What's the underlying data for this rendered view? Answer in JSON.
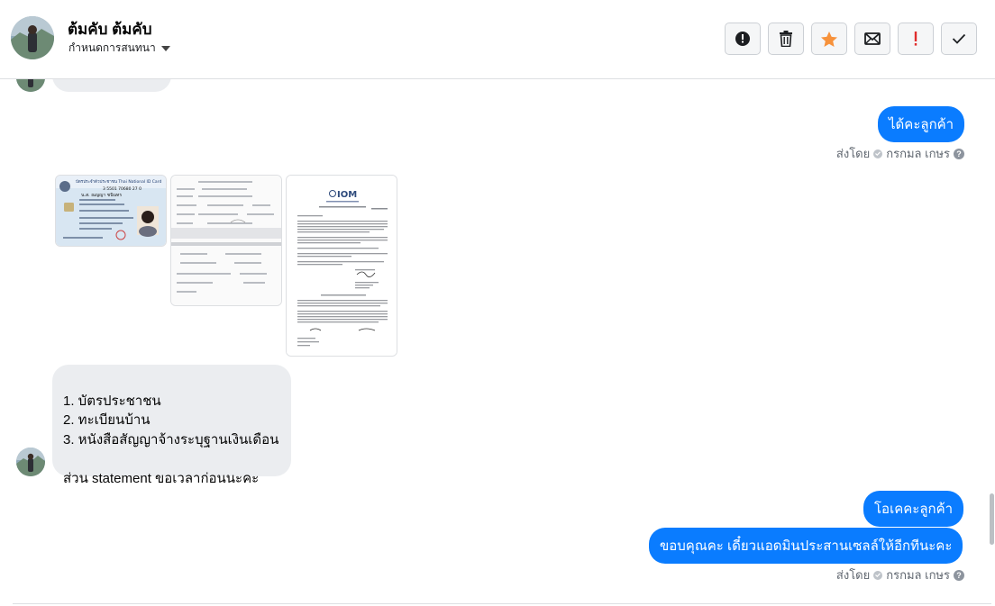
{
  "header": {
    "contact_name": "ต้มคับ ต้มคับ",
    "conversation_settings": "กำหนดการสนทนา",
    "actions": [
      {
        "name": "mark-spam",
        "icon": "exclamation-circle-icon"
      },
      {
        "name": "delete",
        "icon": "trash-icon"
      },
      {
        "name": "star",
        "icon": "star-icon",
        "color": "#f7923b"
      },
      {
        "name": "mark-unread",
        "icon": "envelope-icon"
      },
      {
        "name": "follow-up",
        "icon": "exclamation-icon",
        "color": "#e02d2d"
      },
      {
        "name": "done",
        "icon": "check-icon"
      }
    ]
  },
  "messages": {
    "out_1": "ได้คะลูกค้า",
    "sent_by_1": "ส่งโดย",
    "agent_1": "กรกมล เกษร",
    "incoming_list": "1. บัตรประชาชน\n2. ทะเบียนบ้าน\n3. หนังสือสัญญาจ้างระบุฐานเงินเดือน\n\nส่วน statement ขอเวลาก่อนนะคะ",
    "out_2": "โอเคคะลูกค้า",
    "out_3": "ขอบคุณคะ เดี๋ยวแอดมินประสานเซลล์ให้อีกทีนะคะ",
    "sent_by_2": "ส่งโดย",
    "agent_2": "กรกมล เกษร"
  },
  "attachments": {
    "id_card": {
      "title": "บัตรประจำตัวประชาชน Thai National ID Card",
      "number": "3 5501 70680 27 0",
      "name_th": "น.ส. ณญญา ชนินทร"
    },
    "doc_3": {
      "logo_text": "IOM"
    }
  }
}
